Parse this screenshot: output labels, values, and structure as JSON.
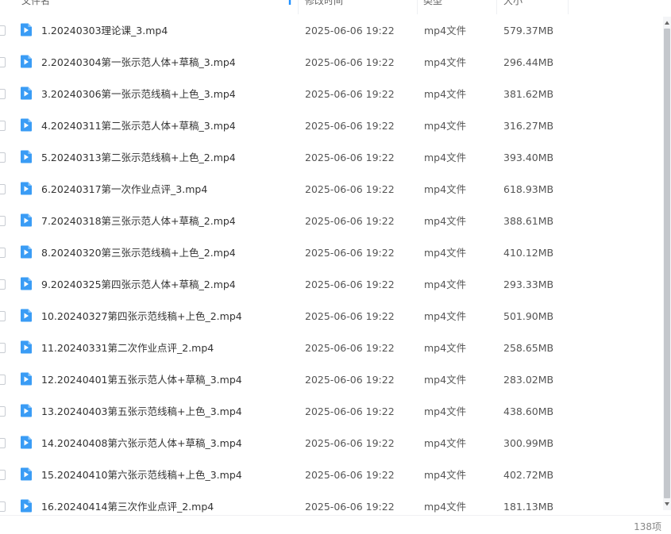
{
  "header": {
    "name": "文件名",
    "date": "修改时间",
    "type": "类型",
    "size": "大小"
  },
  "colors": {
    "icon_blue": "#3a9cf5",
    "sort_blue": "#1e90ff"
  },
  "files": [
    {
      "name": "1.20240303理论课_3.mp4",
      "date": "2025-06-06 19:22",
      "type": "mp4文件",
      "size": "579.37MB"
    },
    {
      "name": "2.20240304第一张示范人体+草稿_3.mp4",
      "date": "2025-06-06 19:22",
      "type": "mp4文件",
      "size": "296.44MB"
    },
    {
      "name": "3.20240306第一张示范线稿+上色_3.mp4",
      "date": "2025-06-06 19:22",
      "type": "mp4文件",
      "size": "381.62MB"
    },
    {
      "name": "4.20240311第二张示范人体+草稿_3.mp4",
      "date": "2025-06-06 19:22",
      "type": "mp4文件",
      "size": "316.27MB"
    },
    {
      "name": "5.20240313第二张示范线稿+上色_2.mp4",
      "date": "2025-06-06 19:22",
      "type": "mp4文件",
      "size": "393.40MB"
    },
    {
      "name": "6.20240317第一次作业点评_3.mp4",
      "date": "2025-06-06 19:22",
      "type": "mp4文件",
      "size": "618.93MB"
    },
    {
      "name": "7.20240318第三张示范人体+草稿_2.mp4",
      "date": "2025-06-06 19:22",
      "type": "mp4文件",
      "size": "388.61MB"
    },
    {
      "name": "8.20240320第三张示范线稿+上色_2.mp4",
      "date": "2025-06-06 19:22",
      "type": "mp4文件",
      "size": "410.12MB"
    },
    {
      "name": "9.20240325第四张示范人体+草稿_2.mp4",
      "date": "2025-06-06 19:22",
      "type": "mp4文件",
      "size": "293.33MB"
    },
    {
      "name": "10.20240327第四张示范线稿+上色_2.mp4",
      "date": "2025-06-06 19:22",
      "type": "mp4文件",
      "size": "501.90MB"
    },
    {
      "name": "11.20240331第二次作业点评_2.mp4",
      "date": "2025-06-06 19:22",
      "type": "mp4文件",
      "size": "258.65MB"
    },
    {
      "name": "12.20240401第五张示范人体+草稿_3.mp4",
      "date": "2025-06-06 19:22",
      "type": "mp4文件",
      "size": "283.02MB"
    },
    {
      "name": "13.20240403第五张示范线稿+上色_3.mp4",
      "date": "2025-06-06 19:22",
      "type": "mp4文件",
      "size": "438.60MB"
    },
    {
      "name": "14.20240408第六张示范人体+草稿_3.mp4",
      "date": "2025-06-06 19:22",
      "type": "mp4文件",
      "size": "300.99MB"
    },
    {
      "name": "15.20240410第六张示范线稿+上色_3.mp4",
      "date": "2025-06-06 19:22",
      "type": "mp4文件",
      "size": "402.72MB"
    },
    {
      "name": "16.20240414第三次作业点评_2.mp4",
      "date": "2025-06-06 19:22",
      "type": "mp4文件",
      "size": "181.13MB"
    }
  ],
  "footer": {
    "count": "138项"
  }
}
